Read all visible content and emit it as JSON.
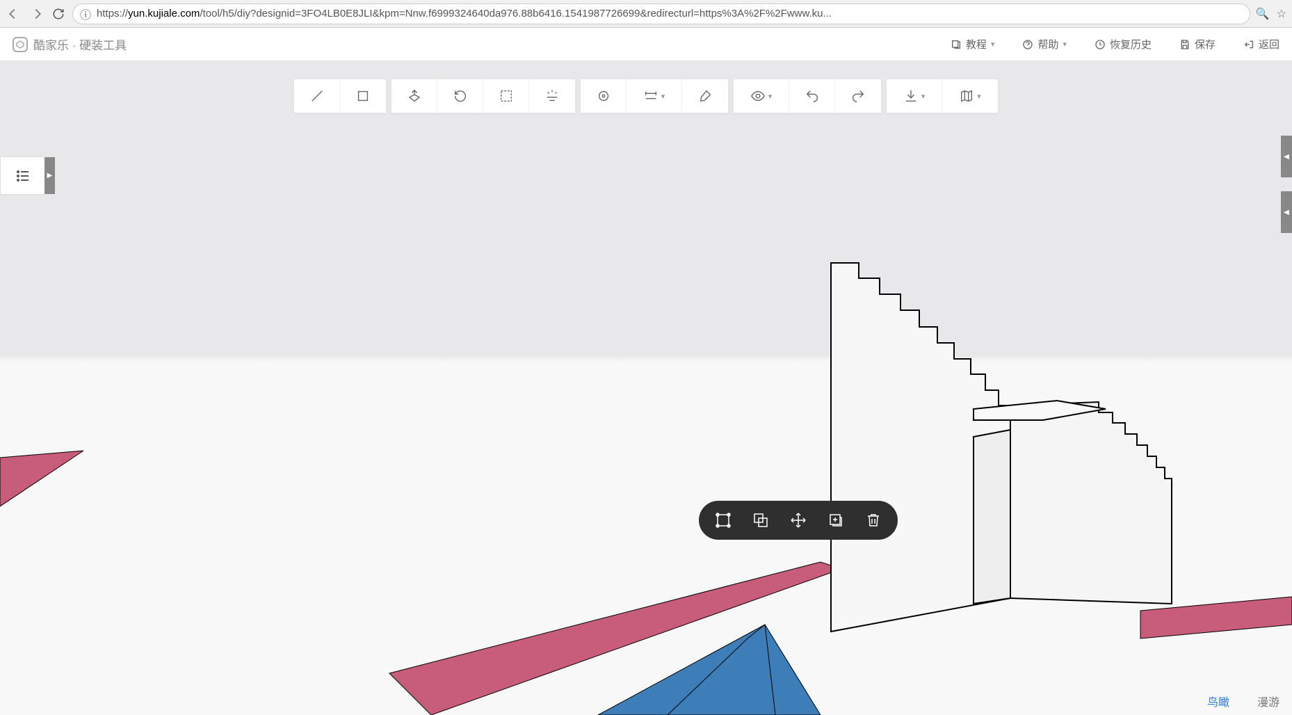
{
  "browser": {
    "url_prefix": "https://",
    "url_host": "yun.kujiale.com",
    "url_path": "/tool/h5/diy?designid=3FO4LB0E8JLI&kpm=Nnw.f6999324640da976.88b6416.1541987726699&redirecturl=https%3A%2F%2Fwww.ku..."
  },
  "brand": {
    "name": "酷家乐",
    "sub": "硬装工具"
  },
  "header": {
    "tutorial": "教程",
    "help": "帮助",
    "restore": "恢复历史",
    "save": "保存",
    "back": "返回"
  },
  "toolbar": {
    "groups": [
      {
        "tools": [
          {
            "id": "line"
          },
          {
            "id": "rect"
          }
        ]
      },
      {
        "tools": [
          {
            "id": "extrude"
          },
          {
            "id": "rotate"
          },
          {
            "id": "frame"
          },
          {
            "id": "light"
          }
        ]
      },
      {
        "tools": [
          {
            "id": "target"
          },
          {
            "id": "measure",
            "dropdown": true
          },
          {
            "id": "brush"
          }
        ]
      },
      {
        "tools": [
          {
            "id": "eye",
            "dropdown": true
          },
          {
            "id": "undo"
          },
          {
            "id": "redo"
          }
        ]
      },
      {
        "tools": [
          {
            "id": "download",
            "dropdown": true
          },
          {
            "id": "map",
            "dropdown": true
          }
        ]
      }
    ]
  },
  "context_pill": {
    "items": [
      "select",
      "group",
      "move",
      "duplicate",
      "delete"
    ]
  },
  "view_modes": {
    "bird": "鸟瞰",
    "roam": "漫游"
  }
}
